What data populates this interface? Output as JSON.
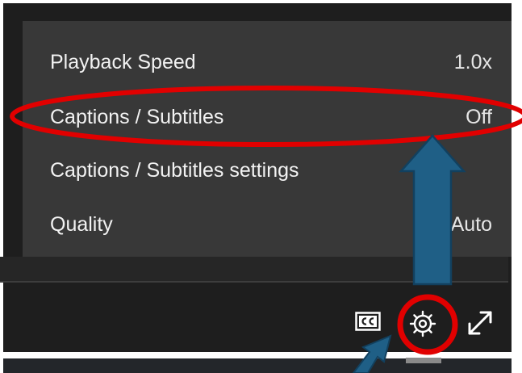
{
  "menu": {
    "items": [
      {
        "label": "Playback Speed",
        "value": "1.0x"
      },
      {
        "label": "Captions / Subtitles",
        "value": "Off"
      },
      {
        "label": "Captions / Subtitles settings",
        "value": ""
      },
      {
        "label": "Quality",
        "value": "Auto"
      }
    ]
  },
  "controls": {
    "cc_icon": "closed-captions-icon",
    "settings_icon": "gear-icon",
    "fullscreen_icon": "expand-arrows-icon"
  },
  "colors": {
    "menu_background": "#383838",
    "player_background": "#1e1e1e",
    "highlight": "#e10000",
    "arrow_fill": "#1f5f86",
    "arrow_stroke": "#12405e"
  }
}
